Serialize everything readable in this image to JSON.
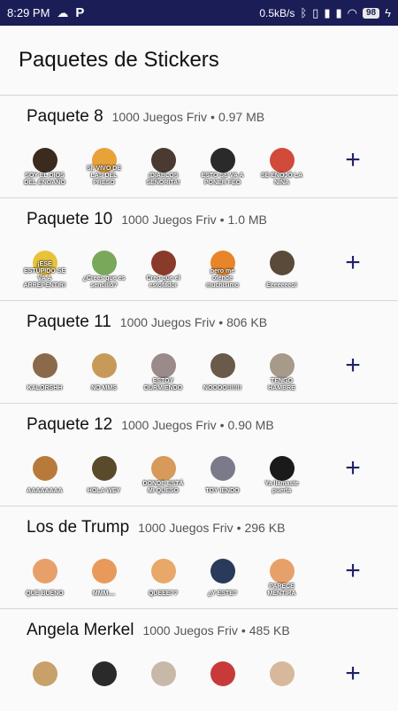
{
  "status_bar": {
    "time": "8:29 PM",
    "network_speed": "0.5kB/s",
    "battery_level": "98"
  },
  "app_bar": {
    "title": "Paquetes de Stickers"
  },
  "packs": [
    {
      "name": "Paquete 8",
      "publisher": "1000 Juegos Friv",
      "size": "0.97 MB",
      "stickers": [
        {
          "caption": "SOY EL DIOS DEL ENGAÑO",
          "color": "#3b2a1e"
        },
        {
          "caption": "SÍ, VIVO DE LAS DEL PRESO",
          "color": "#e8a23a"
        },
        {
          "caption": "¡DIABLOS SEÑORITA!",
          "color": "#4a3a32"
        },
        {
          "caption": "ESTO SE VA A PONER FEO",
          "color": "#2a2a2a"
        },
        {
          "caption": "SE ENOJÓ LA NIÑA",
          "color": "#d24a3a"
        }
      ]
    },
    {
      "name": "Paquete 10",
      "publisher": "1000 Juegos Friv",
      "size": "1.0 MB",
      "stickers": [
        {
          "caption": "¡ESE ESTÚPIDO SE VA A ARREPENTIR!",
          "color": "#e8c33a"
        },
        {
          "caption": "¿Crees que es sencillo?",
          "color": "#7aa85a"
        },
        {
          "caption": "Creo que el estofador",
          "color": "#8a3a2a"
        },
        {
          "caption": "pero me ofende muchísimo",
          "color": "#e8842a"
        },
        {
          "caption": "Eeeeeeeo!",
          "color": "#5a4a3a"
        }
      ]
    },
    {
      "name": "Paquete 11",
      "publisher": "1000 Juegos Friv",
      "size": "806 KB",
      "stickers": [
        {
          "caption": "KALORSHH",
          "color": "#8a6a4a"
        },
        {
          "caption": "NO MMS",
          "color": "#c89a5a"
        },
        {
          "caption": "ESTOY DURMIENDO",
          "color": "#9a8a8a"
        },
        {
          "caption": "NOOOO!!!!!!!",
          "color": "#6a5a4a"
        },
        {
          "caption": "TENGO HAMBRE",
          "color": "#a89a8a"
        }
      ]
    },
    {
      "name": "Paquete 12",
      "publisher": "1000 Juegos Friv",
      "size": "0.90 MB",
      "stickers": [
        {
          "caption": "AAAAAAAA",
          "color": "#b87a3a"
        },
        {
          "caption": "HOLA WEY",
          "color": "#5a4a2a"
        },
        {
          "caption": "DONDE ESTÁ MI QUESO",
          "color": "#d89a5a"
        },
        {
          "caption": "TOY IENDO",
          "color": "#7a7a8a"
        },
        {
          "caption": "Ya llamaste puerta",
          "color": "#1a1a1a"
        }
      ]
    },
    {
      "name": "Los de Trump",
      "publisher": "1000 Juegos Friv",
      "size": "296 KB",
      "stickers": [
        {
          "caption": "QUE BUENO",
          "color": "#e8a06a"
        },
        {
          "caption": "MMM....",
          "color": "#e89a5a"
        },
        {
          "caption": "QUEEE??",
          "color": "#e8a86a"
        },
        {
          "caption": "¿Y ESTE?",
          "color": "#2a3a5a"
        },
        {
          "caption": "PARECE MENTIRA",
          "color": "#e8a06a"
        }
      ]
    },
    {
      "name": "Angela Merkel",
      "publisher": "1000 Juegos Friv",
      "size": "485 KB",
      "stickers": [
        {
          "caption": "",
          "color": "#c8a06a"
        },
        {
          "caption": "",
          "color": "#2a2a2a"
        },
        {
          "caption": "",
          "color": "#c8b8a8"
        },
        {
          "caption": "",
          "color": "#c83a3a"
        },
        {
          "caption": "",
          "color": "#d8b89a"
        }
      ]
    }
  ],
  "icons": {
    "add": "+",
    "separator": "•"
  },
  "colors": {
    "status_bar_bg": "#1b1d57",
    "add_button": "#22226a"
  }
}
